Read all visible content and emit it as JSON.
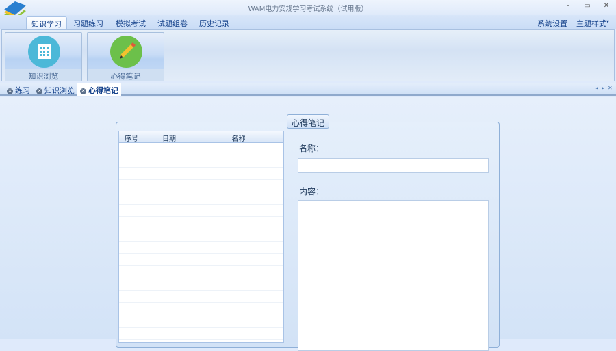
{
  "window": {
    "title": "WAM电力安规学习考试系统（试用版）",
    "minimize": "–",
    "maximize": "▭",
    "close": "✕"
  },
  "ribbon": {
    "tabs": [
      "知识学习",
      "习题练习",
      "模拟考试",
      "试题组卷",
      "历史记录"
    ],
    "right": [
      "系统设置",
      "主题样式"
    ],
    "dropdown": "▾",
    "buttons": [
      {
        "label": "知识浏览",
        "icon": "table-icon"
      },
      {
        "label": "心得笔记",
        "icon": "pencil-icon"
      }
    ]
  },
  "doc_tabs": {
    "tabs": [
      "练习",
      "知识浏览",
      "心得笔记"
    ],
    "nav": [
      "◂",
      "▸",
      "✕"
    ]
  },
  "notes": {
    "group_title": "心得笔记",
    "columns": [
      "序号",
      "日期",
      "名称"
    ],
    "name_label": "名称：",
    "content_label": "内容：",
    "name_value": "",
    "content_value": ""
  },
  "colors": {
    "accent": "#15428b",
    "panel": "#dfeafb"
  }
}
